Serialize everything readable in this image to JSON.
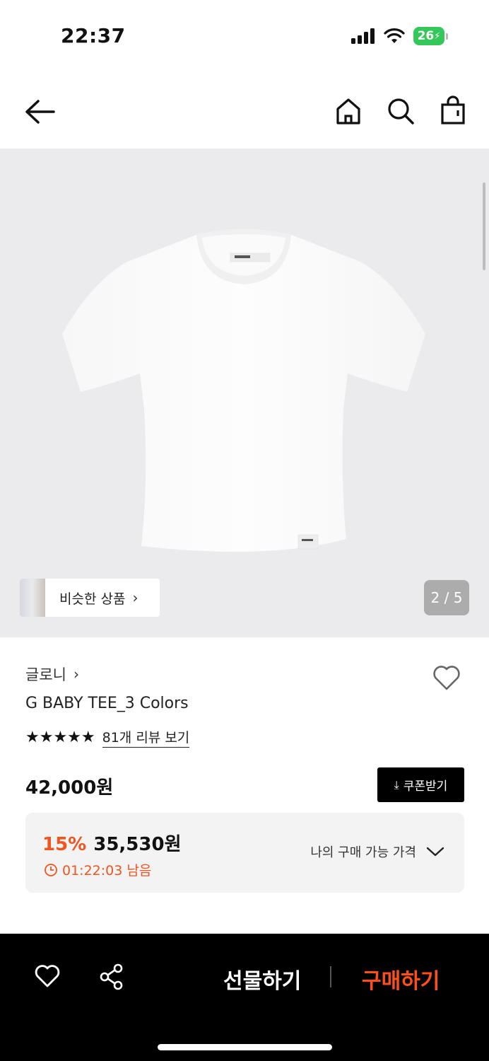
{
  "status_bar": {
    "time": "22:37",
    "battery": "26",
    "icons": [
      "signal-icon",
      "wifi-icon",
      "battery-charging-icon"
    ]
  },
  "nav": {
    "icons": [
      "back-arrow-icon",
      "home-icon",
      "search-icon",
      "shopping-bag-icon"
    ]
  },
  "hero": {
    "similar_label": "비슷한 상품",
    "page_indicator": "2 / 5"
  },
  "product": {
    "brand": "글로니",
    "title": "G BABY TEE_3 Colors",
    "stars": "★★★★★",
    "review_link": "81개 리뷰 보기",
    "price_original": "42,000원",
    "coupon_label": "쿠폰받기",
    "discount_percent": "15%",
    "discount_price": "35,530원",
    "timer": "01:22:03 남음",
    "my_price_label": "나의 구매 가능 가격"
  },
  "bottom_bar": {
    "gift_label": "선물하기",
    "buy_label": "구매하기"
  },
  "colors": {
    "accent": "#f0541f",
    "buy": "#ff4f19",
    "hero_bg": "#ebebed",
    "battery": "#34c759"
  }
}
